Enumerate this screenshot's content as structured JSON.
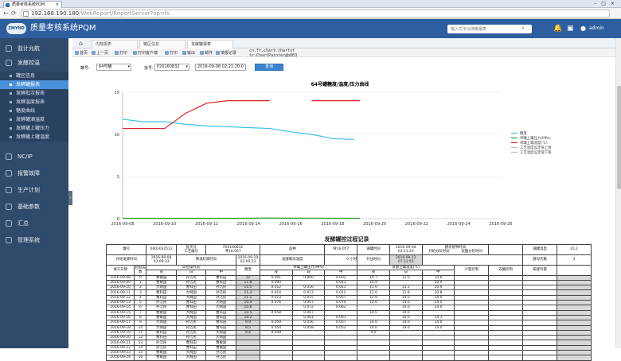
{
  "browser": {
    "tab_title": "质量考核系统PQM",
    "url_host": "192.168.190.180",
    "url_path": "/WebReport/ReportServer?op=fs"
  },
  "header": {
    "logo": "ZMYHD",
    "app_title": "质量考核系统PQM",
    "search_placeholder": "输入文字以搜索报表",
    "user": "admin"
  },
  "sidebar": {
    "groups": [
      {
        "label": "监计允航"
      },
      {
        "label": "发酵控温"
      },
      {
        "label": "NC/IP"
      },
      {
        "label": "报警故障"
      },
      {
        "label": "生产计划"
      },
      {
        "label": "基础参数"
      },
      {
        "label": "汇总"
      },
      {
        "label": "管理系统"
      }
    ],
    "items": [
      {
        "label": "罐区信息"
      },
      {
        "label": "发酵罐报表"
      },
      {
        "label": "发酵批次报表"
      },
      {
        "label": "发酵温度报表"
      },
      {
        "label": "糖度曲线"
      },
      {
        "label": "发酵罐酒温度"
      },
      {
        "label": "发酵罐上罐压力"
      },
      {
        "label": "发酵罐上罐温度"
      }
    ]
  },
  "content_tabs": [
    {
      "label": "内窥报表"
    },
    {
      "label": "罐区信息"
    },
    {
      "label": "发酵罐报表"
    }
  ],
  "toolbar": {
    "items": [
      "首页",
      "上一页",
      "打印",
      "打印客户端",
      "打印",
      "输出",
      "邮件",
      "填报记录"
    ],
    "tip_line1": "cn.fr.chart.chartst",
    "tip_line2": "tr.ChartPainter@b803"
  },
  "params": {
    "tank_label": "罐号:",
    "tank_value": "64号罐",
    "batch_label": "批号:",
    "batch_value": "P20160832",
    "time_value": "2016-09-08 02:21:20.0",
    "query_button": "查询"
  },
  "chart_data": {
    "type": "line",
    "title": "64号罐糖度/温度/压力曲线",
    "ylim": [
      0,
      15
    ],
    "yticks": [
      "0",
      "5",
      "10",
      "15"
    ],
    "x_tick_labels": [
      "2016-09-08",
      "2016-09-10",
      "2016-09-12",
      "2016-09-14",
      "2016-09-16",
      "2016-09-18",
      "2016-09-20",
      "2016-09-22",
      "2016-09-24",
      "2016-09-26"
    ],
    "legend_position": "right",
    "series": [
      {
        "name": "糖度",
        "color": "#3cbfe6",
        "x": [
          0,
          1,
          2,
          3,
          4,
          5,
          6,
          7,
          8,
          9,
          10,
          11
        ],
        "y": [
          11.8,
          11.5,
          11.5,
          11.2,
          11.0,
          10.9,
          10.8,
          10.7,
          10.3,
          10.0,
          9.5,
          9.4
        ]
      },
      {
        "name": "单罐上罐压力(MPa)",
        "color": "#2ca02c",
        "x": [
          0,
          5.5,
          7.0,
          11.3
        ],
        "y": [
          0.05,
          0.05,
          0.07,
          0.05
        ]
      },
      {
        "name": "单罐上罐温度(℃)",
        "color": "#d62728",
        "x": [
          0,
          1,
          2,
          3,
          4,
          5,
          6,
          7
        ],
        "y": [
          10.7,
          10.7,
          10.7,
          12.5,
          13.7,
          14.0,
          14.0,
          14.0
        ],
        "x2": [
          9.0,
          10.0,
          11.0,
          11.3
        ],
        "y2": [
          14.0,
          14.0,
          14.0,
          14.0
        ]
      },
      {
        "name": "工艺温度设定值上限",
        "color": "#bbbbbb",
        "x": [],
        "y": []
      },
      {
        "name": "工艺温度设定值下限",
        "color": "#bbbbbb",
        "x": [],
        "y": []
      }
    ]
  },
  "report": {
    "title": "发酵罐控过程记录",
    "info": {
      "tank_no_label": "罐号",
      "tank_no": "0003032512",
      "batch_label": "批次号",
      "batch": "P20160832",
      "process_label": "工艺编号",
      "process": "啤16-057",
      "variety_label": "品种",
      "variety": "啤16-057",
      "fill_time_label": "满罐时间",
      "fill_time": "2016-09-08 02:21:20",
      "ferment_label": "酵母接种时间",
      "start_label": "开始分阶时间",
      "dual_label": "双酸分阶时间",
      "fill_temp_label": "满罐温度",
      "fill_temp": "10.2",
      "start_ferment_label": "开始发酵时间",
      "start_ferment": "2016-09-08 02:00:33",
      "end_time_label": "降温结束时间",
      "end_time": "2016-09-19 02:00:33",
      "max_temp_label": "发酵最高温度",
      "max_temp": "0",
      "hours_label": "小时",
      "temp_time_label": "升压时间",
      "temp_time": "2016-09-12 07:12:55",
      "ferment_gen_label": "酵母代数",
      "ferment_gen": "3"
    },
    "header": {
      "date": "填写日期",
      "ctrl_days": "控制天数",
      "shift_staff": "岗位操作员",
      "sugar": "糖度",
      "pressure": "单罐上罐压力(MPa)",
      "temp": "发酵上罐温度(℃)",
      "temp_ctrl": "冷量控制",
      "ferment_ctrl": "双酸控制",
      "exhaust": "排酵母量",
      "night": "夜",
      "day": "白",
      "mid": "中"
    },
    "rows": [
      {
        "date": "2016-09-08",
        "day": "0",
        "s1": "曹敏国",
        "s2": "孙洁民",
        "s3": "曹科田",
        "sugar": "12",
        "p1": "0.001",
        "p2": "0.000",
        "p3": "0.002",
        "t1": "10.7",
        "t2": "11.0",
        "t3": "10.8"
      },
      {
        "date": "2016-09-09",
        "day": "1",
        "s1": "曹敏国",
        "s2": "孙洁民",
        "s3": "曹科田",
        "sugar": "11.8",
        "p1": "0.004",
        "p2": "",
        "p3": "0.013",
        "t1": "10.9",
        "t2": "",
        "t3": "10.9"
      },
      {
        "date": "2016-09-10",
        "day": "2",
        "s1": "大网国",
        "s2": "曹科田",
        "s3": "孙洁民",
        "sugar": "11.5",
        "p1": "0.012",
        "p2": "0.016",
        "p3": "0.013",
        "t1": "11.0",
        "t2": "11.1",
        "t3": "10.9"
      },
      {
        "date": "2016-09-11",
        "day": "3",
        "s1": "曹科田",
        "s2": "大网国",
        "s3": "孙洁民",
        "sugar": "11.3",
        "p1": "0.014",
        "p2": "0.013",
        "p3": "0.012",
        "t1": "11.0",
        "t2": "11.9",
        "t3": "10.8"
      },
      {
        "date": "2016-09-12",
        "day": "4",
        "s1": "曹科田",
        "s2": "大网国",
        "s3": "孙洁民",
        "sugar": "11.1",
        "p1": "0.013",
        "p2": "0.015",
        "p3": "0.057",
        "t1": "12.9",
        "t2": "14.0",
        "t3": "14.0"
      },
      {
        "date": "2016-09-13",
        "day": "5",
        "s1": "孙洁民",
        "s2": "曹科田",
        "s3": "大网国",
        "sugar": "10.9",
        "p1": "0.076",
        "p2": "0.067",
        "p3": "0.074",
        "t1": "14.0",
        "t2": "14.0",
        "t3": "14.0"
      },
      {
        "date": "2016-09-14",
        "day": "6",
        "s1": "孙洁民",
        "s2": "曹科田",
        "s3": "大网国",
        "sugar": "10.8",
        "p1": "",
        "p2": "0.072",
        "p3": "0.062",
        "t1": "",
        "t2": "14.0",
        "t3": "14.0"
      },
      {
        "date": "2016-09-15",
        "day": "7",
        "s1": "曹敏国",
        "s2": "大网国",
        "s3": "曹科田",
        "sugar": "10.5",
        "p1": "0.058",
        "p2": "0.067",
        "p3": "",
        "t1": "14.0",
        "t2": "14.0",
        "t3": ""
      },
      {
        "date": "2016-09-16",
        "day": "8",
        "s1": "曹敏国",
        "s2": "大网国",
        "s3": "曹科田",
        "sugar": "10.2",
        "p1": "",
        "p2": "0.061",
        "p3": "0.061",
        "t1": "",
        "t2": "14.0",
        "t3": "14.1"
      },
      {
        "date": "2016-09-17",
        "day": "9",
        "s1": "大网国",
        "s2": "孙洁民",
        "s3": "曹科田",
        "sugar": "9.9",
        "p1": "0.059",
        "p2": "0.056",
        "p3": "0.057",
        "t1": "14.0",
        "t2": "14.0",
        "t3": "14.0"
      },
      {
        "date": "2016-09-18",
        "day": "10",
        "s1": "大网国",
        "s2": "孙洁民",
        "s3": "曹科田",
        "sugar": "9.5",
        "p1": "0.050",
        "p2": "0.058",
        "p3": "0.052",
        "t1": "14.0",
        "t2": "14.0",
        "t3": "14.0"
      },
      {
        "date": "2016-09-19",
        "day": "11",
        "s1": "曹科田",
        "s2": "孙洁民",
        "s3": "大网国",
        "sugar": "9.4",
        "p1": "0.049",
        "p2": "",
        "p3": "",
        "t1": "9.0",
        "t2": "",
        "t3": ""
      },
      {
        "date": "2016-09-20",
        "day": "12",
        "s1": "曹科田",
        "s2": "孙洁民",
        "s3": "大网国",
        "sugar": "",
        "p1": "",
        "p2": "",
        "p3": "",
        "t1": "",
        "t2": "",
        "t3": ""
      },
      {
        "date": "2016-09-21",
        "day": "13",
        "s1": "孙洁民",
        "s2": "曹科田",
        "s3": "曹敏国",
        "sugar": "",
        "p1": "",
        "p2": "",
        "p3": "",
        "t1": "",
        "t2": "",
        "t3": ""
      },
      {
        "date": "2016-09-22",
        "day": "14",
        "s1": "孙洁民",
        "s2": "曹科田",
        "s3": "曹敏国",
        "sugar": "",
        "p1": "",
        "p2": "",
        "p3": "",
        "t1": "",
        "t2": "",
        "t3": ""
      },
      {
        "date": "2016-09-23",
        "day": "15",
        "s1": "曹敏国",
        "s2": "大网国",
        "s3": "孙洁民",
        "sugar": "",
        "p1": "",
        "p2": "",
        "p3": "",
        "t1": "",
        "t2": "",
        "t3": ""
      },
      {
        "date": "2016-09-24",
        "day": "16",
        "s1": "曹敏国",
        "s2": "大网国",
        "s3": "孙洁民",
        "sugar": "",
        "p1": "",
        "p2": "",
        "p3": "",
        "t1": "",
        "t2": "",
        "t3": ""
      }
    ]
  }
}
